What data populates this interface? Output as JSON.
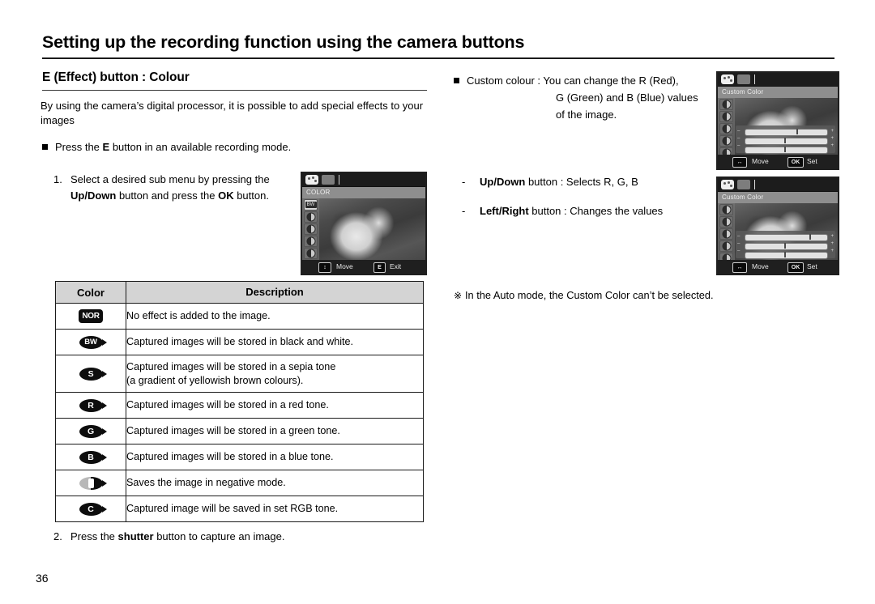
{
  "document": {
    "page_title": "Setting up the recording function using the camera buttons",
    "section_title": "E (Effect) button : Colour",
    "page_number": "36"
  },
  "left_column": {
    "intro": "By using the camera’s digital processor, it is possible to add special effects to your images",
    "bullet_press_e_pre": "Press the ",
    "bullet_press_e_bold": "E",
    "bullet_press_e_post": " button in an available recording mode.",
    "step1_number": "1.",
    "step1_part1": "Select a desired sub menu by pressing the ",
    "step1_bold1": "Up/Down",
    "step1_part2": " button and press the ",
    "step1_bold2": "OK",
    "step1_part3": " button.",
    "step2_number": "2.",
    "step2_part1": "Press the ",
    "step2_bold1": "shutter",
    "step2_part2": " button to capture an image."
  },
  "color_table": {
    "headers": [
      "Color",
      "Description"
    ],
    "rows": [
      {
        "icon": "nor-icon",
        "icon_label": "NOR",
        "icon_style": "rect",
        "description": "No effect is added to the image.",
        "lines": 1
      },
      {
        "icon": "bw-icon",
        "icon_label": "BW",
        "icon_style": "oval",
        "description": "Captured images will be stored in black and white.",
        "lines": 1
      },
      {
        "icon": "sepia-icon",
        "icon_label": "S",
        "icon_style": "oval",
        "description": "Captured images will be stored in a sepia tone\n(a gradient of yellowish brown colours).",
        "lines": 2
      },
      {
        "icon": "red-icon",
        "icon_label": "R",
        "icon_style": "oval",
        "description": "Captured images will be stored in a red tone.",
        "lines": 1
      },
      {
        "icon": "green-icon",
        "icon_label": "G",
        "icon_style": "oval",
        "description": "Captured images will be stored in a green tone.",
        "lines": 1
      },
      {
        "icon": "blue-icon",
        "icon_label": "B",
        "icon_style": "oval",
        "description": "Captured images will be stored in a blue tone.",
        "lines": 1
      },
      {
        "icon": "negative-icon",
        "icon_label": "",
        "icon_style": "negative",
        "description": "Saves the image in negative mode.",
        "lines": 1
      },
      {
        "icon": "custom-color-icon",
        "icon_label": "C",
        "icon_style": "oval",
        "description": "Captured image will be saved in set RGB tone.",
        "lines": 1
      }
    ]
  },
  "right_column": {
    "custom_colour_label": "Custom colour : You can change the R (Red),",
    "custom_colour_line2": "G (Green) and B (Blue) values",
    "custom_colour_line3": "of the image.",
    "buttons": [
      {
        "dash": "-",
        "bold": "Up/Down",
        "rest": " button  : Selects R, G, B"
      },
      {
        "dash": "-",
        "bold": "Left/Right",
        "rest": " button : Changes the values"
      }
    ],
    "note_star": "※",
    "note_text": "In the Auto mode, the Custom Color can’t be selected."
  },
  "lcd_left": {
    "menu_title": "COLOR",
    "selected_item_label": "BW",
    "bottom_move_label": "Move",
    "bottom_key": "E",
    "bottom_action_label": "Exit",
    "nav_icon": "up-down-arrows-icon"
  },
  "lcd_right_top": {
    "menu_title": "Custom Color",
    "bottom_move_label": "Move",
    "bottom_key": "OK",
    "bottom_action_label": "Set",
    "nav_icon": "left-right-arrows-icon",
    "rgb_knobs": [
      62,
      48,
      48
    ]
  },
  "lcd_right_bottom": {
    "menu_title": "Custom Color",
    "bottom_move_label": "Move",
    "bottom_key": "OK",
    "bottom_action_label": "Set",
    "nav_icon": "left-right-arrows-icon",
    "rgb_knobs": [
      78,
      48,
      48
    ]
  }
}
